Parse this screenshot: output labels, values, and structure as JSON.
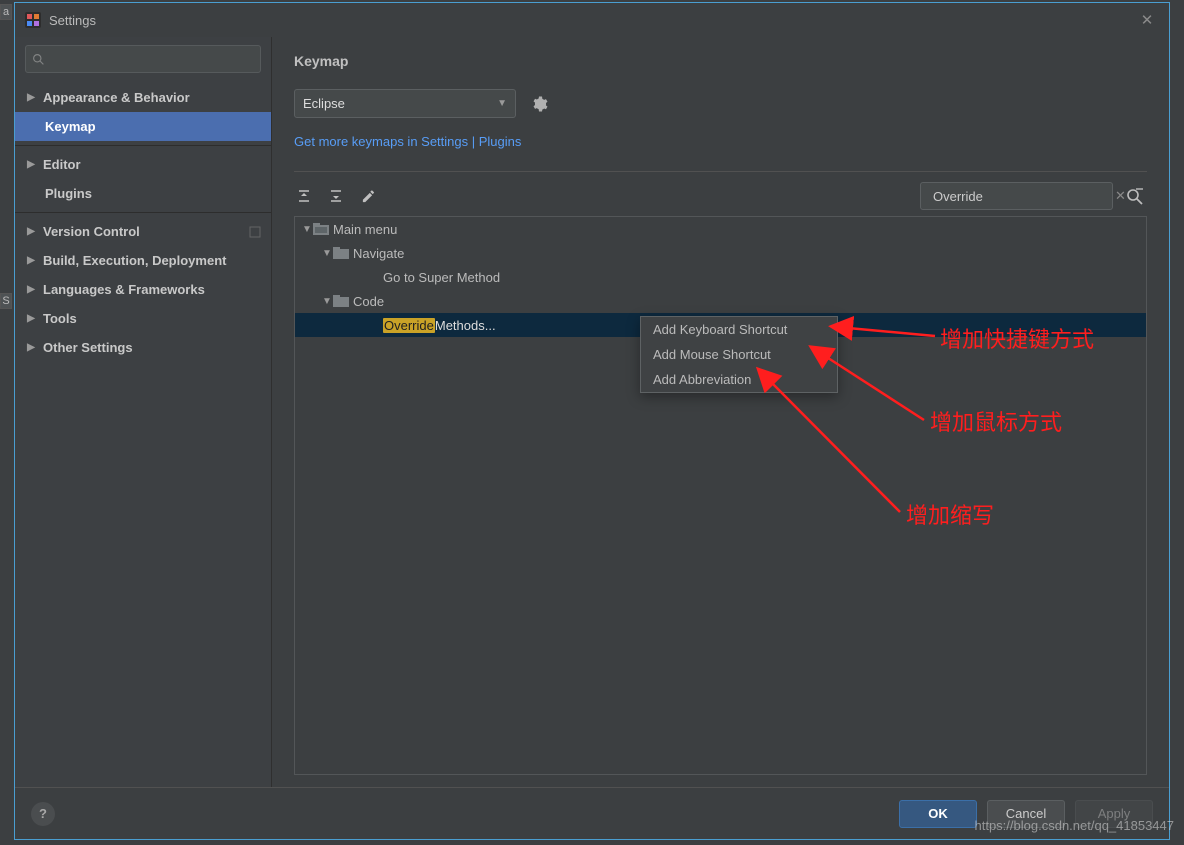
{
  "window": {
    "title": "Settings"
  },
  "sidebar": {
    "search_placeholder": "",
    "items": [
      {
        "label": "Appearance & Behavior",
        "bold": true,
        "arrow": true
      },
      {
        "label": "Keymap",
        "bold": true,
        "child": true,
        "selected": true
      },
      {
        "label": "Editor",
        "bold": true,
        "arrow": true
      },
      {
        "label": "Plugins",
        "bold": true,
        "child": true
      },
      {
        "label": "Version Control",
        "bold": true,
        "arrow": true,
        "trail_icon": true
      },
      {
        "label": "Build, Execution, Deployment",
        "bold": true,
        "arrow": true
      },
      {
        "label": "Languages & Frameworks",
        "bold": true,
        "arrow": true
      },
      {
        "label": "Tools",
        "bold": true,
        "arrow": true
      },
      {
        "label": "Other Settings",
        "bold": true,
        "arrow": true
      }
    ]
  },
  "main": {
    "title": "Keymap",
    "scheme": "Eclipse",
    "more_link": "Get more keymaps in Settings | Plugins",
    "action_search": "Override",
    "tree": {
      "n0": "Main menu",
      "n1": "Navigate",
      "n2": "Go to Super Method",
      "n3": "Code",
      "n4_hl": "Override",
      "n4_rest": " Methods..."
    }
  },
  "popup": {
    "item0": "Add Keyboard Shortcut",
    "item1": "Add Mouse Shortcut",
    "item2": "Add Abbreviation"
  },
  "footer": {
    "ok": "OK",
    "cancel": "Cancel",
    "apply": "Apply"
  },
  "annotations": {
    "a0": "增加快捷键方式",
    "a1": "增加鼠标方式",
    "a2": "增加缩写"
  },
  "watermark": "https://blog.csdn.net/qq_41853447"
}
